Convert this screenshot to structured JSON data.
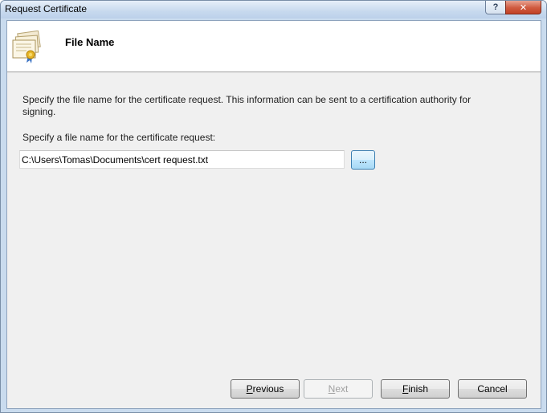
{
  "window": {
    "title": "Request Certificate",
    "help_button": "?",
    "close_button": "✕"
  },
  "header": {
    "title": "File Name",
    "icon": "certificate-icon"
  },
  "content": {
    "description": "Specify the file name for the certificate request. This information can be sent to a certification authority for signing.",
    "field_label": "Specify a file name for the certificate request:",
    "file_path": "C:\\Users\\Tomas\\Documents\\cert request.txt",
    "browse_label": "..."
  },
  "footer": {
    "previous": {
      "mnemonic": "P",
      "rest": "revious"
    },
    "next": {
      "mnemonic": "N",
      "rest": "ext",
      "enabled": false
    },
    "finish": {
      "mnemonic": "F",
      "rest": "inish"
    },
    "cancel": "Cancel"
  },
  "colors": {
    "background": "#f0f0f0",
    "header": "#ffffff",
    "accent": "#3c7fb1"
  }
}
